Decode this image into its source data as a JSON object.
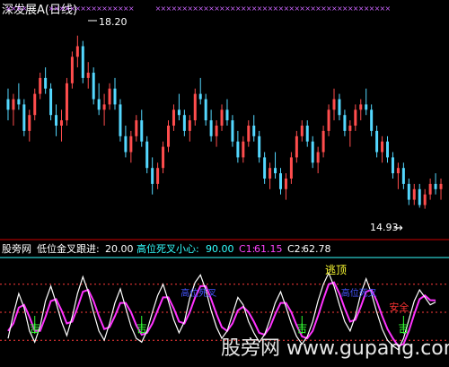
{
  "header": {
    "title": "深发展A(日线)"
  },
  "price_panel": {
    "high_label": "18.20",
    "low_label": "14.93",
    "low_arrow": "→"
  },
  "indicator_bar": {
    "name": "股旁网",
    "p1_label": "低位金叉跟进:",
    "p1_value": "20.00",
    "p2_label": "高位死叉小心:",
    "p2_value": "90.00",
    "c1_label": "C1:",
    "c1_value": "61.15",
    "c2_label": "C2:",
    "c2_value": "62.78"
  },
  "signals": {
    "top_label": "逃顶",
    "buy_label": "吉",
    "safe_label": "安全",
    "dead_label": "高位死叉"
  },
  "watermark": "股旁网  www.gupang.com",
  "colors": {
    "up": "#ff4d4d",
    "down": "#54d8ff",
    "k_line": "#ffffff",
    "d_line": "#ff33ff",
    "ref_line": "#ff3b3b",
    "ref_line2": "#33ffff",
    "header": "#ffffff",
    "panel_border": "#cc0000",
    "c1": "#ff44ff",
    "c2": "#ffffff",
    "p2": "#33ffff",
    "top_text": "#ffff33",
    "buy_text": "#33ff33",
    "safe_text": "#ff3333",
    "dead_text": "#4455ff"
  },
  "chart_data": {
    "type": "candlestick",
    "price_ylim": [
      14.5,
      18.5
    ],
    "candles": [
      [
        17.0,
        17.2,
        16.6,
        16.8
      ],
      [
        16.8,
        17.1,
        16.5,
        17.0
      ],
      [
        17.0,
        17.3,
        16.8,
        16.9
      ],
      [
        16.9,
        17.0,
        16.3,
        16.4
      ],
      [
        16.4,
        16.8,
        16.2,
        16.7
      ],
      [
        16.7,
        17.2,
        16.6,
        17.1
      ],
      [
        17.1,
        17.5,
        17.0,
        17.4
      ],
      [
        17.4,
        17.6,
        17.1,
        17.2
      ],
      [
        17.2,
        17.3,
        16.6,
        16.7
      ],
      [
        16.7,
        16.9,
        16.3,
        16.5
      ],
      [
        16.5,
        16.8,
        16.2,
        16.6
      ],
      [
        16.6,
        17.4,
        16.5,
        17.3
      ],
      [
        17.3,
        17.9,
        17.2,
        17.8
      ],
      [
        17.8,
        18.2,
        17.6,
        18.0
      ],
      [
        18.0,
        18.1,
        17.3,
        17.4
      ],
      [
        17.4,
        17.7,
        17.2,
        17.5
      ],
      [
        17.5,
        17.6,
        16.9,
        17.0
      ],
      [
        17.0,
        17.3,
        16.7,
        16.8
      ],
      [
        16.8,
        17.1,
        16.5,
        16.9
      ],
      [
        16.9,
        17.3,
        16.8,
        17.2
      ],
      [
        17.2,
        17.4,
        16.8,
        16.9
      ],
      [
        16.9,
        17.0,
        16.2,
        16.3
      ],
      [
        16.3,
        16.5,
        15.9,
        16.0
      ],
      [
        16.0,
        16.4,
        15.8,
        16.3
      ],
      [
        16.3,
        16.7,
        16.2,
        16.6
      ],
      [
        16.6,
        16.8,
        16.1,
        16.2
      ],
      [
        16.2,
        16.3,
        15.6,
        15.7
      ],
      [
        15.7,
        15.9,
        15.2,
        15.4
      ],
      [
        15.4,
        15.8,
        15.3,
        15.7
      ],
      [
        15.7,
        16.2,
        15.6,
        16.1
      ],
      [
        16.1,
        16.6,
        16.0,
        16.5
      ],
      [
        16.5,
        16.9,
        16.4,
        16.8
      ],
      [
        16.8,
        17.1,
        16.6,
        16.7
      ],
      [
        16.7,
        16.8,
        16.3,
        16.4
      ],
      [
        16.4,
        16.7,
        16.2,
        16.6
      ],
      [
        16.6,
        17.2,
        16.5,
        17.1
      ],
      [
        17.1,
        17.4,
        16.9,
        17.0
      ],
      [
        17.0,
        17.1,
        16.5,
        16.6
      ],
      [
        16.6,
        16.8,
        16.2,
        16.3
      ],
      [
        16.3,
        16.6,
        16.1,
        16.5
      ],
      [
        16.5,
        16.9,
        16.4,
        16.8
      ],
      [
        16.8,
        17.0,
        16.5,
        16.6
      ],
      [
        16.6,
        16.7,
        16.1,
        16.2
      ],
      [
        16.2,
        16.4,
        15.8,
        15.9
      ],
      [
        15.9,
        16.3,
        15.8,
        16.2
      ],
      [
        16.2,
        16.6,
        16.1,
        16.5
      ],
      [
        16.5,
        16.7,
        16.2,
        16.3
      ],
      [
        16.3,
        16.4,
        15.8,
        15.9
      ],
      [
        15.9,
        16.0,
        15.4,
        15.5
      ],
      [
        15.5,
        15.8,
        15.3,
        15.7
      ],
      [
        15.7,
        16.0,
        15.5,
        15.6
      ],
      [
        15.6,
        15.7,
        15.2,
        15.3
      ],
      [
        15.3,
        15.6,
        15.1,
        15.5
      ],
      [
        15.5,
        16.0,
        15.4,
        15.9
      ],
      [
        15.9,
        16.4,
        15.8,
        16.3
      ],
      [
        16.3,
        16.6,
        16.2,
        16.5
      ],
      [
        16.5,
        16.6,
        16.1,
        16.2
      ],
      [
        16.2,
        16.3,
        15.7,
        15.8
      ],
      [
        15.8,
        16.1,
        15.6,
        16.0
      ],
      [
        16.0,
        16.5,
        15.9,
        16.4
      ],
      [
        16.4,
        16.9,
        16.3,
        16.8
      ],
      [
        16.8,
        17.2,
        16.6,
        17.0
      ],
      [
        17.0,
        17.1,
        16.6,
        16.7
      ],
      [
        16.7,
        16.8,
        16.3,
        16.4
      ],
      [
        16.4,
        16.6,
        16.1,
        16.5
      ],
      [
        16.5,
        16.9,
        16.4,
        16.8
      ],
      [
        16.8,
        17.0,
        16.6,
        16.9
      ],
      [
        16.9,
        17.2,
        16.7,
        16.8
      ],
      [
        16.8,
        16.9,
        16.3,
        16.4
      ],
      [
        16.4,
        16.5,
        15.9,
        16.0
      ],
      [
        16.0,
        16.3,
        15.8,
        16.2
      ],
      [
        16.2,
        16.3,
        15.8,
        15.9
      ],
      [
        15.9,
        16.0,
        15.5,
        15.6
      ],
      [
        15.6,
        15.8,
        15.3,
        15.7
      ],
      [
        15.7,
        15.8,
        15.3,
        15.4
      ],
      [
        15.4,
        15.5,
        15.0,
        15.1
      ],
      [
        15.1,
        15.4,
        15.0,
        15.3
      ],
      [
        15.3,
        15.4,
        14.95,
        15.0
      ],
      [
        15.0,
        15.3,
        14.93,
        15.2
      ],
      [
        15.2,
        15.5,
        15.1,
        15.4
      ],
      [
        15.4,
        15.6,
        15.2,
        15.3
      ],
      [
        15.3,
        15.5,
        15.1,
        15.4
      ]
    ],
    "indicator_ylim": [
      0,
      100
    ],
    "indicator_levels": [
      20,
      50,
      80
    ],
    "K": [
      22,
      48,
      70,
      55,
      30,
      18,
      35,
      62,
      78,
      60,
      40,
      25,
      45,
      70,
      88,
      72,
      50,
      30,
      20,
      38,
      60,
      75,
      55,
      35,
      22,
      18,
      30,
      50,
      68,
      80,
      62,
      42,
      28,
      40,
      65,
      82,
      90,
      74,
      52,
      34,
      22,
      30,
      48,
      66,
      58,
      40,
      28,
      18,
      26,
      42,
      60,
      72,
      56,
      38,
      24,
      16,
      24,
      40,
      62,
      80,
      92,
      78,
      58,
      40,
      30,
      46,
      70,
      86,
      70,
      50,
      32,
      20,
      14,
      10,
      22,
      42,
      62,
      74,
      66,
      58,
      61
    ],
    "D": [
      30,
      38,
      55,
      58,
      45,
      30,
      30,
      45,
      62,
      64,
      52,
      38,
      40,
      55,
      72,
      74,
      62,
      46,
      32,
      34,
      46,
      60,
      60,
      50,
      36,
      26,
      28,
      38,
      52,
      66,
      66,
      54,
      40,
      38,
      50,
      66,
      78,
      78,
      64,
      48,
      34,
      30,
      38,
      52,
      56,
      50,
      40,
      28,
      26,
      34,
      48,
      60,
      60,
      50,
      36,
      24,
      22,
      30,
      46,
      64,
      80,
      82,
      70,
      54,
      40,
      42,
      56,
      72,
      74,
      62,
      46,
      32,
      22,
      14,
      16,
      30,
      48,
      64,
      68,
      63,
      62.78
    ],
    "markers": [
      {
        "label": "buy",
        "bar": 5
      },
      {
        "label": "buy",
        "bar": 25
      },
      {
        "label": "buy",
        "bar": 55
      },
      {
        "label": "top",
        "bar": 61
      },
      {
        "label": "safe",
        "bar": 73
      },
      {
        "label": "buy",
        "bar": 74
      },
      {
        "label": "dead",
        "bar": 36
      },
      {
        "label": "dead",
        "bar": 66
      }
    ],
    "cross_markers": [
      0,
      1,
      2,
      3,
      8,
      9,
      10,
      11,
      12,
      13,
      14,
      15,
      16,
      17,
      18,
      19,
      20,
      21,
      22,
      23,
      28,
      29,
      30,
      31,
      32,
      33,
      34,
      35,
      36,
      37,
      38,
      39,
      40,
      41,
      42,
      43,
      44,
      45,
      46,
      47,
      48,
      49,
      50,
      51,
      52,
      53,
      54,
      55,
      56,
      57,
      58,
      59,
      60,
      61,
      62,
      63,
      64,
      65,
      66,
      67,
      68,
      69,
      70,
      71
    ]
  }
}
